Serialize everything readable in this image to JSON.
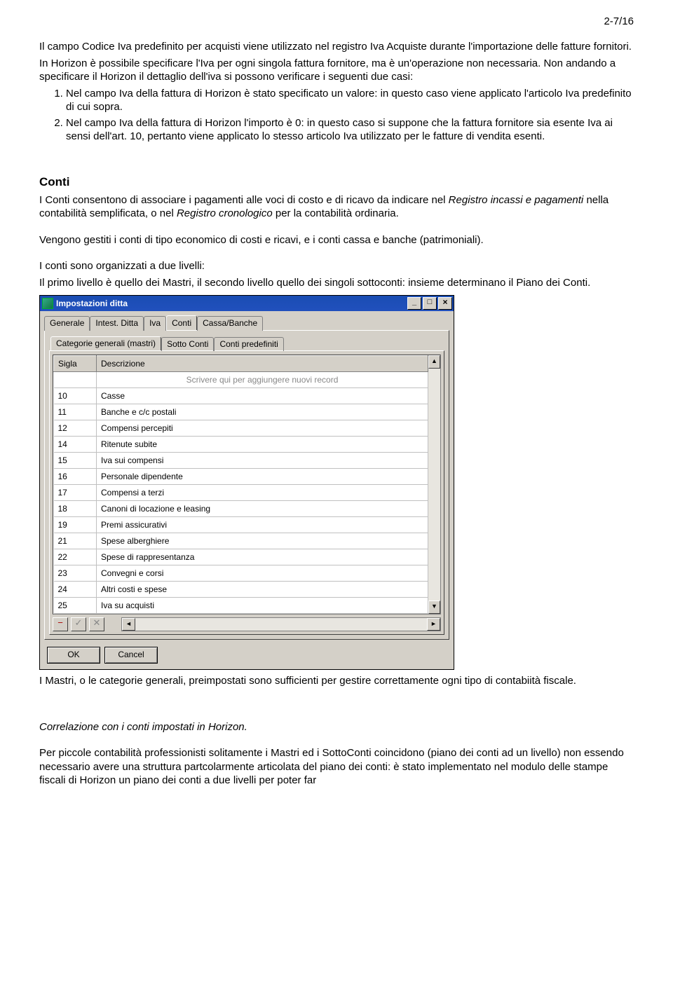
{
  "page_number": "2-7/16",
  "para1": "Il campo Codice Iva predefinito per acquisti viene utilizzato nel registro Iva Acquiste durante l'importazione delle fatture fornitori.",
  "para2": "In Horizon è possibile specificare l'Iva per ogni singola fattura fornitore, ma è un'operazione non necessaria. Non andando a specificare il Horizon il dettaglio dell'iva si possono verificare i seguenti due casi:",
  "li1": "Nel campo Iva della fattura di Horizon è stato specificato un valore: in questo caso viene applicato l'articolo Iva predefinito di cui sopra.",
  "li2": "Nel campo Iva della fattura di Horizon l'importo è 0: in questo caso si suppone che la fattura fornitore sia esente Iva ai sensi dell'art. 10, pertanto viene applicato lo stesso articolo Iva utilizzato per le fatture di vendita esenti.",
  "conti_heading": "Conti",
  "conti_p1a": "I Conti consentono di associare i pagamenti alle voci di costo e di ricavo da indicare nel ",
  "conti_p1b": "Registro incassi e pagamenti",
  "conti_p1c": " nella contabilità semplificata, o nel ",
  "conti_p1d": "Registro cronologico",
  "conti_p1e": " per la contabilità ordinaria.",
  "conti_p2": "Vengono gestiti i conti di tipo economico di costi e ricavi, e i conti cassa e banche (patrimoniali).",
  "conti_p3a": "I conti sono organizzati a due livelli:",
  "conti_p3b": "Il primo livello è quello dei Mastri, il secondo livello quello dei singoli sottoconti: insieme determinano il Piano dei Conti.",
  "after_win": "I Mastri, o le categorie generali, preimpostati sono sufficienti per gestire correttamente ogni tipo di contabiità fiscale.",
  "correl_heading": "Correlazione con i conti impostati in Horizon.",
  "last_para": "Per piccole contabilità professionisti solitamente i Mastri ed i SottoConti coincidono (piano dei conti ad un livello) non essendo necessario avere una struttura partcolarmente articolata del piano dei conti: è stato implementato nel modulo delle stampe fiscali di Horizon un piano dei conti a due livelli per poter far",
  "window": {
    "title": "Impostazioni ditta",
    "tabs": [
      "Generale",
      "Intest. Ditta",
      "Iva",
      "Conti",
      "Cassa/Banche"
    ],
    "subtabs": [
      "Categorie generali (mastri)",
      "Sotto Conti",
      "Conti predefiniti"
    ],
    "col_sigla": "Sigla",
    "col_descr": "Descrizione",
    "new_row_hint": "Scrivere qui per aggiungere nuovi record",
    "rows": [
      {
        "s": "10",
        "d": "Casse"
      },
      {
        "s": "11",
        "d": "Banche e c/c postali"
      },
      {
        "s": "12",
        "d": "Compensi percepiti"
      },
      {
        "s": "14",
        "d": "Ritenute subite"
      },
      {
        "s": "15",
        "d": "Iva sui compensi"
      },
      {
        "s": "16",
        "d": "Personale dipendente"
      },
      {
        "s": "17",
        "d": "Compensi a terzi"
      },
      {
        "s": "18",
        "d": "Canoni di locazione e leasing"
      },
      {
        "s": "19",
        "d": "Premi assicurativi"
      },
      {
        "s": "21",
        "d": "Spese alberghiere"
      },
      {
        "s": "22",
        "d": "Spese di rappresentanza"
      },
      {
        "s": "23",
        "d": "Convegni e corsi"
      },
      {
        "s": "24",
        "d": "Altri costi e spese"
      },
      {
        "s": "25",
        "d": "Iva su acquisti"
      }
    ],
    "ok": "OK",
    "cancel": "Cancel"
  }
}
